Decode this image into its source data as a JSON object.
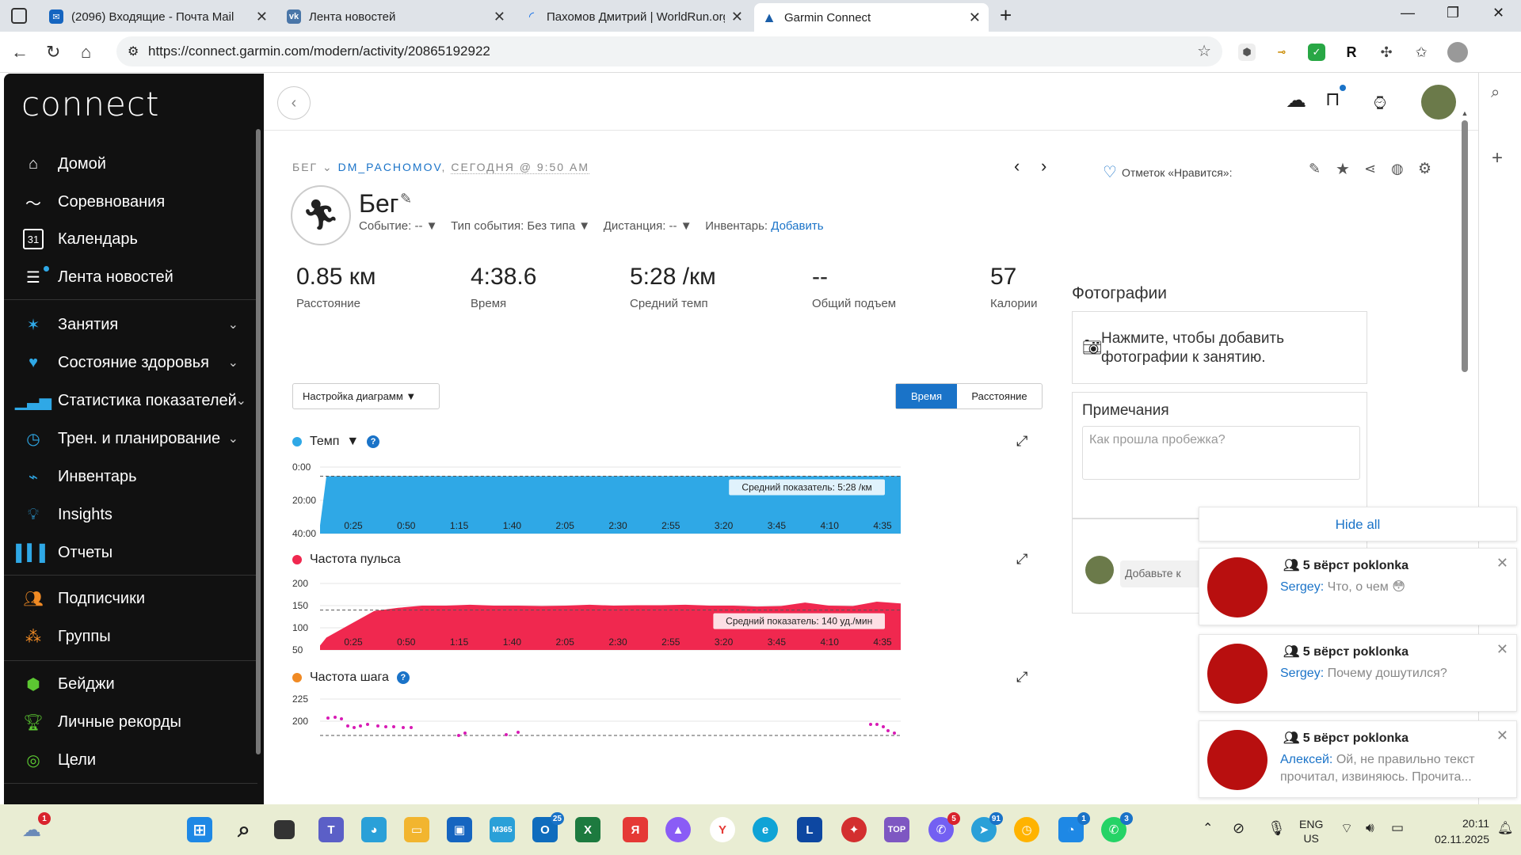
{
  "browser": {
    "tabs": [
      {
        "title": "(2096) Входящие - Почта Mail",
        "icon": "mail-icon",
        "color": "#1565c0"
      },
      {
        "title": "Лента новостей",
        "icon": "vk-icon",
        "color": "#4a76a8"
      },
      {
        "title": "Пахомов Дмитрий | WorldRun.org",
        "icon": "loading-icon",
        "color": "#1a73e8"
      },
      {
        "title": "Garmin Connect",
        "icon": "garmin-icon",
        "color": "#1a5ea8"
      }
    ],
    "new_tab": "+",
    "url": "https://connect.garmin.com/modern/activity/20865192922"
  },
  "sidebar": {
    "logo": "connect",
    "items": [
      {
        "label": "Домой",
        "icon": "home-icon"
      },
      {
        "label": "Соревнования",
        "icon": "competition-icon"
      },
      {
        "label": "Календарь",
        "icon": "calendar-icon"
      },
      {
        "label": "Лента новостей",
        "icon": "newsfeed-icon"
      },
      {
        "label": "Занятия",
        "icon": "activity-icon"
      },
      {
        "label": "Состояние здоровья",
        "icon": "heart-icon"
      },
      {
        "label": "Статистика показателей",
        "icon": "stats-icon"
      },
      {
        "label": "Трен. и планирование",
        "icon": "stopwatch-icon"
      },
      {
        "label": "Инвентарь",
        "icon": "shoe-icon"
      },
      {
        "label": "Insights",
        "icon": "lightbulb-icon"
      },
      {
        "label": "Отчеты",
        "icon": "reports-icon"
      },
      {
        "label": "Подписчики",
        "icon": "followers-icon"
      },
      {
        "label": "Группы",
        "icon": "groups-icon"
      },
      {
        "label": "Бейджи",
        "icon": "badge-icon"
      },
      {
        "label": "Личные рекорды",
        "icon": "trophy-icon"
      },
      {
        "label": "Цели",
        "icon": "target-icon"
      }
    ]
  },
  "activity": {
    "type": "БЕГ",
    "user": "DM_PACHOMOV",
    "when": "СЕГОДНЯ @ 9:50 AM",
    "title": "Бег",
    "event": "Событие: --",
    "event_type": "Тип события: Без типа",
    "distance_sel": "Дистанция: --",
    "gear_label": "Инвентарь:",
    "gear_link": "Добавить",
    "likes": "Отметок «Нравится»:",
    "metrics": [
      {
        "value": "0.85 км",
        "label": "Расстояние"
      },
      {
        "value": "4:38.6",
        "label": "Время"
      },
      {
        "value": "5:28 /км",
        "label": "Средний темп"
      },
      {
        "value": "--",
        "label": "Общий подъем"
      },
      {
        "value": "57",
        "label": "Калории"
      }
    ],
    "chart_settings": "Настройка диаграмм",
    "toggle_time": "Время",
    "toggle_distance": "Расстояние"
  },
  "photos": {
    "title": "Фотографии",
    "prompt": "Нажмите, чтобы добавить фотографии к занятию."
  },
  "notes": {
    "title": "Примечания",
    "placeholder": "Как прошла пробежка?"
  },
  "comment": {
    "placeholder": "Добавьте к"
  },
  "notifications": {
    "hide_all": "Hide all",
    "items": [
      {
        "group": "5 вёрст poklonka",
        "author": "Sergey:",
        "text": "Что, о чем 😳"
      },
      {
        "group": "5 вёрст poklonka",
        "author": "Sergey:",
        "text": "Почему дошутился?"
      },
      {
        "group": "5 вёрст poklonka",
        "author": "Алексей:",
        "text": "Ой, не правильно текст прочитал, извиняюсь. Прочита..."
      }
    ]
  },
  "taskbar": {
    "lang": "ENG",
    "region": "US",
    "time": "20:11",
    "date": "02.11.2025",
    "badges": {
      "weather": "1",
      "ms365": "25",
      "viber": "5",
      "telegram": "91",
      "messenger": "1",
      "whatsapp": "3"
    }
  },
  "chart_data": [
    {
      "type": "area",
      "title": "Темп",
      "color": "#2fa8e6",
      "x": [
        "0:25",
        "0:50",
        "1:15",
        "1:40",
        "2:05",
        "2:30",
        "2:55",
        "3:20",
        "3:45",
        "4:10",
        "4:35"
      ],
      "y_ticks": [
        "0:00",
        "20:00",
        "40:00"
      ],
      "y_values_min_per_km": [
        5.5,
        5.4,
        5.4,
        5.5,
        5.5,
        5.4,
        5.4,
        5.5,
        5.4,
        5.5,
        5.3
      ],
      "avg_label": "Средний показатель: 5:28 /км",
      "avg": 5.47,
      "ylim": [
        0,
        40
      ],
      "y_inverted": true
    },
    {
      "type": "area",
      "title": "Частота пульса",
      "color": "#f0284f",
      "x": [
        "0:25",
        "0:50",
        "1:15",
        "1:40",
        "2:05",
        "2:30",
        "2:55",
        "3:20",
        "3:45",
        "4:10",
        "4:35"
      ],
      "y_ticks": [
        "200",
        "150",
        "100",
        "50"
      ],
      "y_values_bpm": [
        78,
        108,
        138,
        145,
        150,
        150,
        152,
        150,
        150,
        149,
        150,
        152,
        150,
        151,
        151,
        152,
        150,
        150,
        148,
        149,
        157,
        150,
        149,
        159,
        155
      ],
      "avg_label": "Средний показатель: 140 уд./мин",
      "avg": 140,
      "ylim": [
        50,
        200
      ]
    },
    {
      "type": "scatter",
      "title": "Частота шага",
      "color": "#d81bb5",
      "y_ticks": [
        "225",
        "200"
      ],
      "ylim": [
        175,
        235
      ]
    }
  ]
}
